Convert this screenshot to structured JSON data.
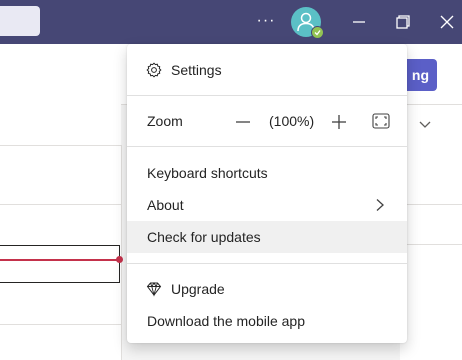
{
  "titlebar": {
    "more_label": "···",
    "window_controls": [
      "minimize-icon",
      "maximize-icon",
      "close-icon"
    ]
  },
  "background": {
    "join_button_partial": "ng"
  },
  "menu": {
    "settings_label": "Settings",
    "zoom_label": "Zoom",
    "zoom_value": "(100%)",
    "keyboard_shortcuts_label": "Keyboard shortcuts",
    "about_label": "About",
    "check_updates_label": "Check for updates",
    "upgrade_label": "Upgrade",
    "download_mobile_label": "Download the mobile app"
  },
  "colors": {
    "titlebar": "#464775",
    "accent": "#5b5fc7",
    "avatar": "#5bc0c6",
    "presence": "#92c353",
    "now_line": "#c4314b",
    "hover_row": "#f0f0f0"
  }
}
